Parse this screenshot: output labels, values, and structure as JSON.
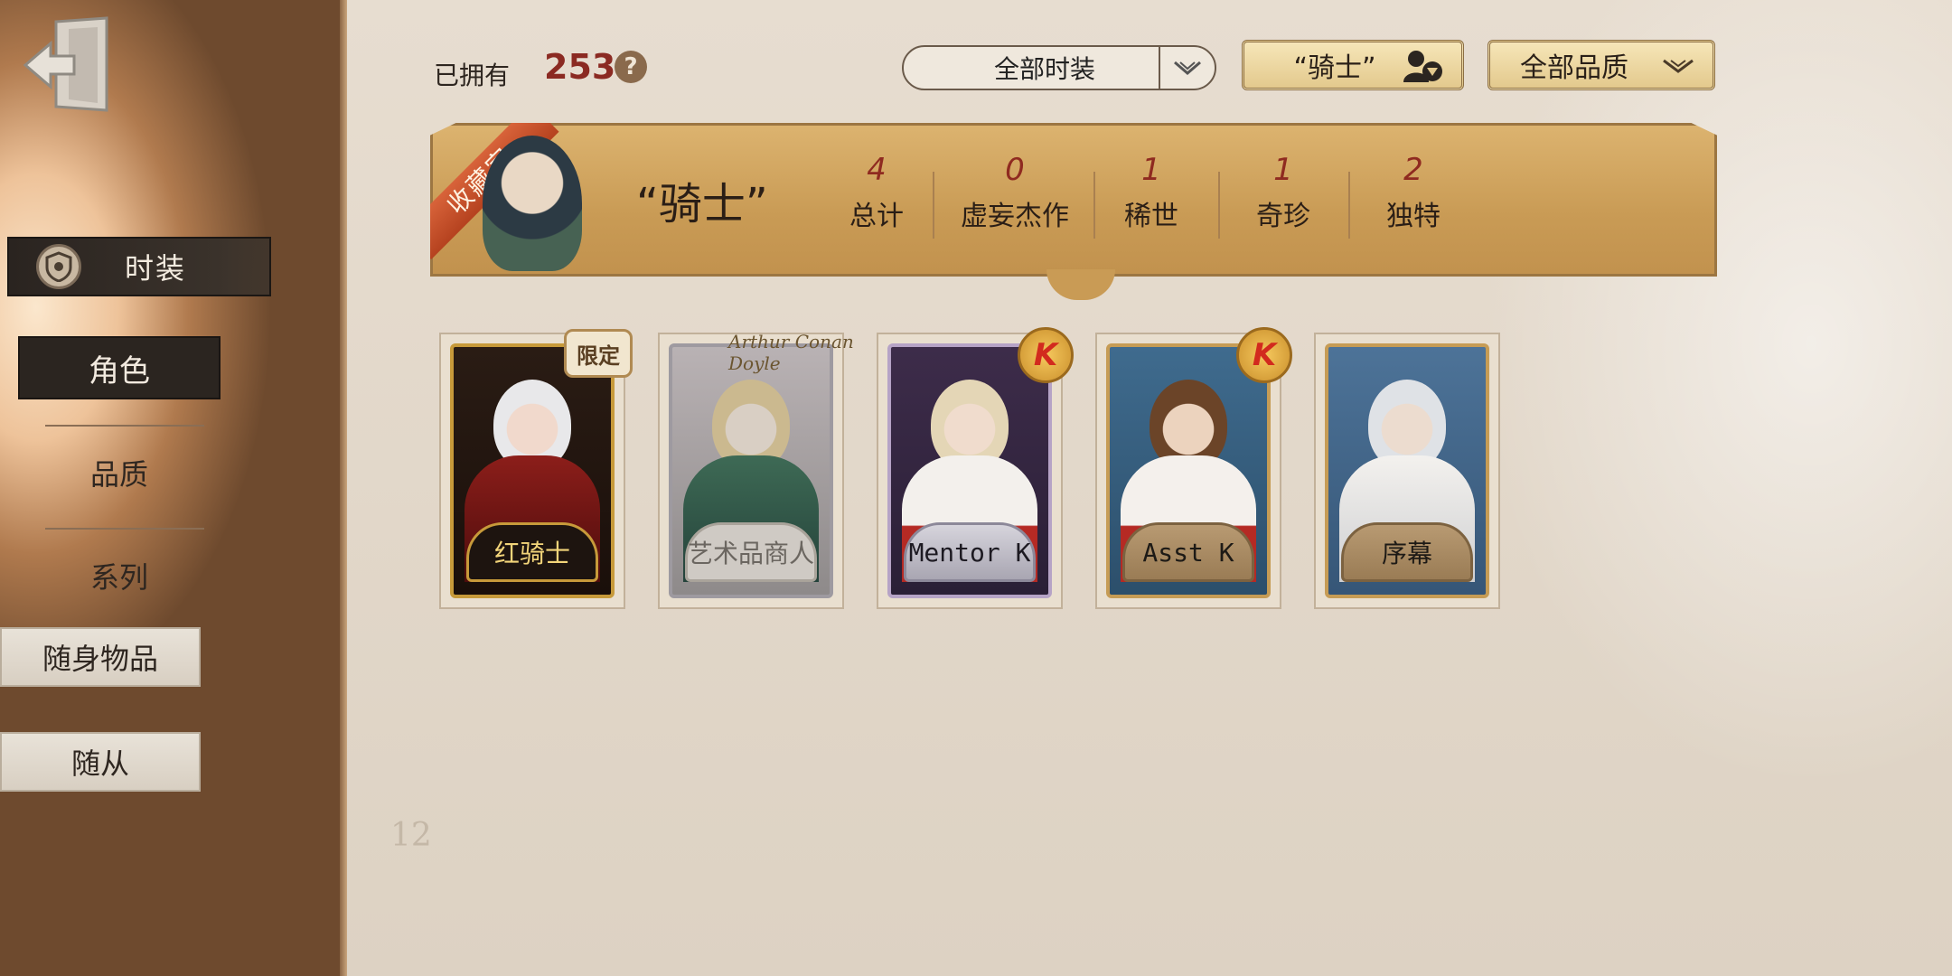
{
  "sidebar": {
    "section_label": "时装",
    "items": [
      {
        "label": "角色",
        "active": true
      },
      {
        "label": "品质",
        "active": false
      },
      {
        "label": "系列",
        "active": false
      },
      {
        "label": "随身物品",
        "active": false
      },
      {
        "label": "随从",
        "active": false
      }
    ]
  },
  "toolbar": {
    "owned_label": "已拥有",
    "owned_count": "253",
    "help": "?",
    "filter_all": "全部时装",
    "filter_character": "“骑士”",
    "filter_quality": "全部品质"
  },
  "banner": {
    "ribbon": "收藏家",
    "title": "“骑士”",
    "stats": [
      {
        "value": "4",
        "label": "总计"
      },
      {
        "value": "0",
        "label": "虚妄杰作"
      },
      {
        "value": "1",
        "label": "稀世"
      },
      {
        "value": "1",
        "label": "奇珍"
      },
      {
        "value": "2",
        "label": "独特"
      }
    ]
  },
  "cards": [
    {
      "name": "红骑士",
      "tag": "限定"
    },
    {
      "name": "艺术品商人",
      "tag": "Arthur Conan Doyle"
    },
    {
      "name": "Mentor K",
      "tag": "K"
    },
    {
      "name": "Asst K",
      "tag": "K"
    },
    {
      "name": "序幕",
      "tag": ""
    }
  ],
  "colors": {
    "accent_red": "#8b2a22",
    "banner_gold": "#c99b55",
    "sidebar_dark": "#2b2520"
  },
  "background_text": {
    "page_number": "12"
  }
}
